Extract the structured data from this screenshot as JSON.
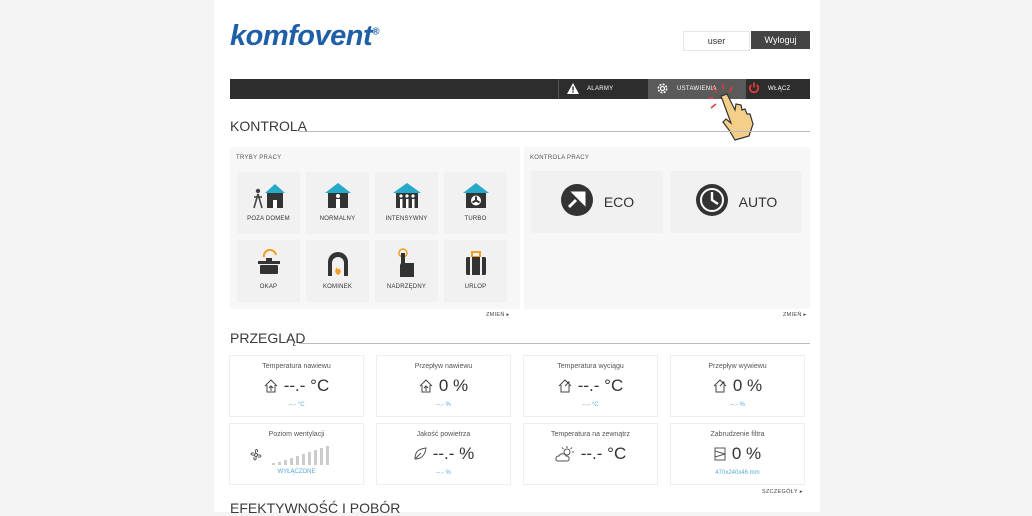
{
  "header": {
    "logo_text": "komfovent",
    "logo_mark": "®",
    "user_label": "user",
    "logout_label": "Wyloguj"
  },
  "topbar": {
    "alarm_label": "ALARMY",
    "settings_label": "USTAWIENIA",
    "on_label": "WŁĄCZ"
  },
  "colors": {
    "brand": "#1f5fa8",
    "topbar": "#2d2d2d",
    "power_icon": "#e03a3a",
    "secondary_text": "#5aa9d6"
  },
  "kontrola": {
    "title": "KONTROLA",
    "modes_label": "TRYBY PRACY",
    "modes": [
      {
        "label": "POZA DOMEM",
        "icon": "away-home-icon"
      },
      {
        "label": "NORMALNY",
        "icon": "normal-home-icon"
      },
      {
        "label": "INTENSYWNY",
        "icon": "intensive-home-icon"
      },
      {
        "label": "TURBO",
        "icon": "turbo-home-icon"
      },
      {
        "label": "OKAP",
        "icon": "hood-icon"
      },
      {
        "label": "KOMINEK",
        "icon": "fireplace-icon"
      },
      {
        "label": "NADRZĘDNY",
        "icon": "override-icon"
      },
      {
        "label": "URLOP",
        "icon": "holiday-icon"
      }
    ],
    "modes_more": "ZMIEŃ",
    "control_label": "KONTROLA PRACY",
    "controls": [
      {
        "label": "ECO",
        "icon": "eco-icon"
      },
      {
        "label": "AUTO",
        "icon": "auto-clock-icon"
      }
    ],
    "control_more": "ZMIEŃ"
  },
  "przeglad": {
    "title": "PRZEGLĄD",
    "cards": [
      {
        "title": "Temperatura nawiewu",
        "value": "--.- °C",
        "sub": "--.- °C",
        "icon": "supply-house-icon"
      },
      {
        "title": "Przepływ nawiewu",
        "value": "0 %",
        "sub": "--.- %",
        "icon": "supply-house-icon"
      },
      {
        "title": "Temperatura wyciągu",
        "value": "--.- °C",
        "sub": "--.- °C",
        "icon": "extract-house-icon"
      },
      {
        "title": "Przepływ wywiewu",
        "value": "0 %",
        "sub": "--.- %",
        "icon": "extract-house-icon"
      },
      {
        "title": "Poziom wentylacji",
        "value": "",
        "sub": "WYŁĄCZONE",
        "icon": "fan-icon"
      },
      {
        "title": "Jakość powietrza",
        "value": "--.- %",
        "sub": "--.- %",
        "icon": "leaf-icon"
      },
      {
        "title": "Temperatura na zewnątrz",
        "value": "--.- °C",
        "sub": "",
        "icon": "weather-icon"
      },
      {
        "title": "Zabrudzenie filtra",
        "value": "0 %",
        "sub": "470x240x46 mm",
        "icon": "filter-icon"
      }
    ],
    "details_link": "SZCZEGÓŁY"
  },
  "bottom": {
    "title": "EFEKTYWNOŚĆ I POBÓR"
  }
}
